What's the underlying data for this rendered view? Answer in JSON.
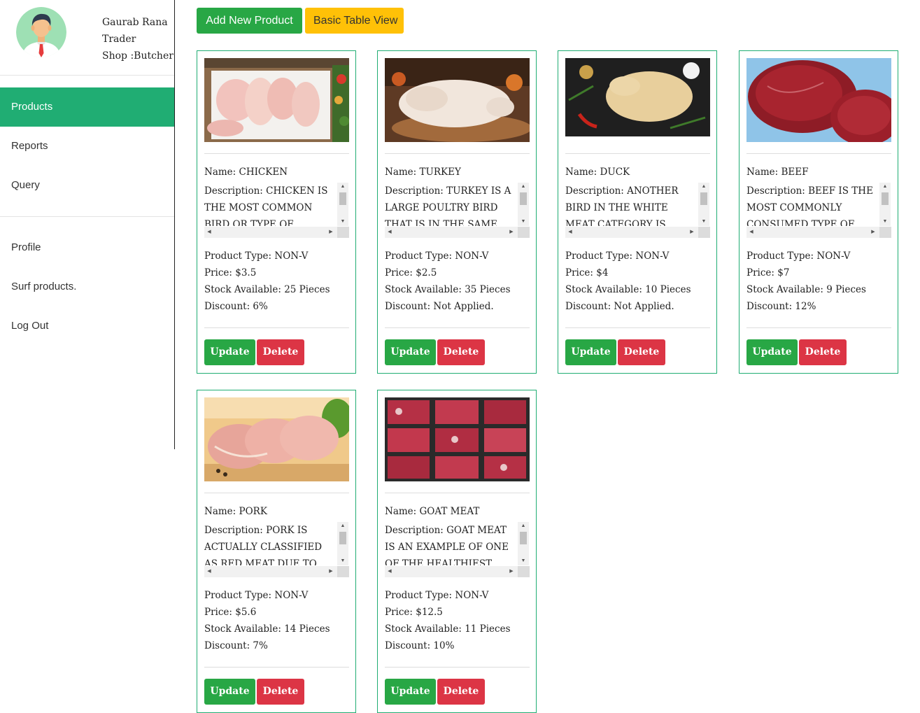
{
  "user": {
    "name": "Gaurab Rana",
    "role": "Trader",
    "shop": "Shop :Butcher"
  },
  "nav": {
    "main": [
      "Products",
      "Reports",
      "Query"
    ],
    "secondary": [
      "Profile",
      "Surf products.",
      "Log Out"
    ],
    "active": "Products"
  },
  "toolbar": {
    "add_label": "Add New Product",
    "table_label": "Basic Table View"
  },
  "labels": {
    "name": "Name: ",
    "description": "Description: ",
    "type": "Product Type: ",
    "price": "Price: ",
    "stock": "Stock Available: ",
    "discount": "Discount: ",
    "update": "Update",
    "delete": "Delete"
  },
  "products": [
    {
      "name": "CHICKEN",
      "description": "CHICKEN IS THE MOST COMMON BIRD OR TYPE OF POULTRY THAT IS",
      "type": "NON-V",
      "price": "$3.5",
      "stock": "25 Pieces",
      "discount": "6%"
    },
    {
      "name": "TURKEY",
      "description": "TURKEY IS A LARGE POULTRY BIRD THAT IS IN THE SAME WHITE",
      "type": "NON-V",
      "price": "$2.5",
      "stock": "35 Pieces",
      "discount": "Not Applied."
    },
    {
      "name": "DUCK",
      "description": "ANOTHER BIRD IN THE WHITE MEAT CATEGORY IS DUCK, EVEN",
      "type": "NON-V",
      "price": "$4",
      "stock": "10 Pieces",
      "discount": "Not Applied."
    },
    {
      "name": "BEEF",
      "description": "BEEF IS THE MOST COMMONLY CONSUMED TYPE OF RED",
      "type": "NON-V",
      "price": "$7",
      "stock": "9 Pieces",
      "discount": "12%"
    },
    {
      "name": "PORK",
      "description": "PORK IS ACTUALLY CLASSIFIED AS RED MEAT DUE TO LEVELS",
      "type": "NON-V",
      "price": "$5.6",
      "stock": "14 Pieces",
      "discount": "7%"
    },
    {
      "name": "GOAT MEAT",
      "description": "GOAT MEAT IS AN EXAMPLE OF ONE OF THE HEALTHIEST TYPES OF RED",
      "type": "NON-V",
      "price": "$12.5",
      "stock": "11 Pieces",
      "discount": "10%"
    }
  ],
  "colors": {
    "accent": "#20ad73",
    "success": "#28a745",
    "danger": "#dc3545",
    "warning": "#ffc107"
  }
}
